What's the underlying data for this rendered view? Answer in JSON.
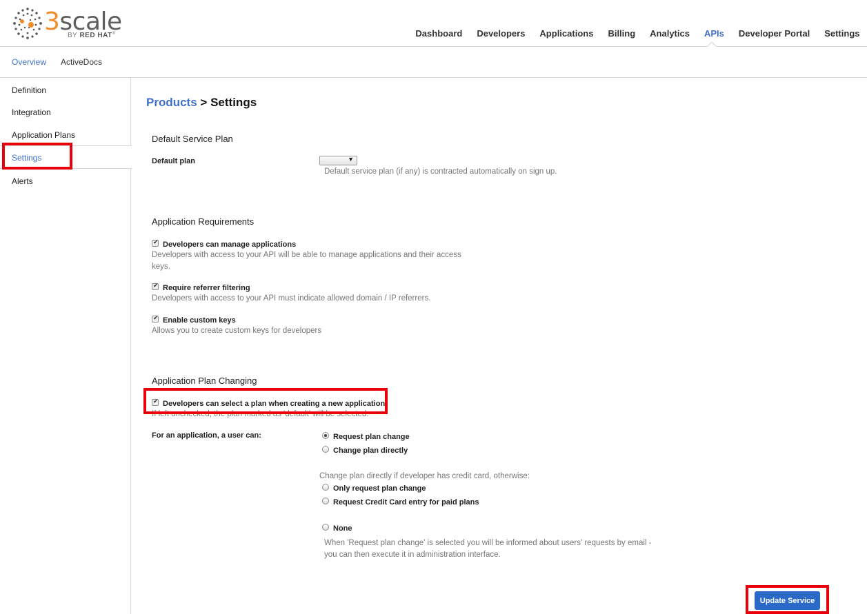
{
  "brand": {
    "name_prefix": "3",
    "name_rest": "scale",
    "by": "BY",
    "company": "RED HAT",
    "tm": "®"
  },
  "topnav": [
    "Dashboard",
    "Developers",
    "Applications",
    "Billing",
    "Analytics",
    "APIs",
    "Developer Portal",
    "Settings"
  ],
  "topnav_active": "APIs",
  "subnav": {
    "overview": "Overview",
    "activedocs": "ActiveDocs"
  },
  "sidebar": {
    "items": [
      "Definition",
      "Integration",
      "Application Plans",
      "Settings",
      "Alerts"
    ]
  },
  "breadcrumb": {
    "link": "Products",
    "separator": ">",
    "current": "Settings"
  },
  "default_plan_section": {
    "title": "Default Service Plan",
    "label": "Default plan",
    "select_value": "",
    "hint": "Default service plan (if any) is contracted automatically on sign up."
  },
  "requirements_section": {
    "title": "Application Requirements",
    "items": [
      {
        "label": "Developers can manage applications",
        "hint_line1": "Developers with access to your API will be able to manage applications and their access",
        "hint_line2": "keys.",
        "checked": true
      },
      {
        "label": "Require referrer filtering",
        "hint": "Developers with access to your API must indicate allowed domain / IP referrers.",
        "checked": true
      },
      {
        "label": "Enable custom keys",
        "hint": "Allows you to create custom keys for developers",
        "checked": true
      }
    ]
  },
  "plan_changing_section": {
    "title": "Application Plan Changing",
    "select_plan_label": "Developers can select a plan when creating a new application",
    "select_plan_hint": "If left unchecked, the plan marked as 'default' will be selected.",
    "user_can_label": "For an application, a user can:",
    "options": [
      {
        "label": "Request plan change",
        "selected": true
      },
      {
        "label": "Change plan directly",
        "selected": false
      }
    ],
    "credit_card_hint": "Change plan directly if developer has credit card, otherwise:",
    "credit_options": [
      {
        "label": "Only request plan change",
        "selected": false
      },
      {
        "label": "Request Credit Card entry for paid plans",
        "selected": false
      }
    ],
    "none_label": "None",
    "none_hint_line1": "When 'Request plan change' is selected you will be informed about users' requests by email -",
    "none_hint_line2": "you can then execute it in administration interface."
  },
  "actions": {
    "update": "Update Service"
  },
  "colors": {
    "accent": "#3f70c9",
    "highlight": "#e8000b",
    "brand_orange": "#f28c28",
    "button": "#2b69c9"
  }
}
